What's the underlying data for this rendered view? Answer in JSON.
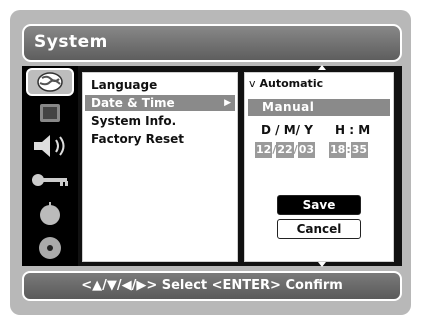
{
  "window": {
    "title": "System"
  },
  "sidebar_icons": [
    {
      "name": "globe-icon"
    },
    {
      "name": "monitor-icon"
    },
    {
      "name": "speaker-icon"
    },
    {
      "name": "key-icon"
    },
    {
      "name": "palette-icon"
    },
    {
      "name": "disc-icon"
    }
  ],
  "menu": {
    "items": [
      {
        "label": "Language"
      },
      {
        "label": "Date & Time",
        "selected": true
      },
      {
        "label": "System Info."
      },
      {
        "label": "Factory Reset"
      }
    ]
  },
  "datetime": {
    "automatic": {
      "check": "v",
      "label": "Automatic"
    },
    "manual_label": "Manual",
    "date_label": "D / M/ Y",
    "time_label": "H : M",
    "day": "12",
    "month": "22",
    "year": "03",
    "hour": "18",
    "minute": "35",
    "date_sep": "/",
    "time_sep": ":",
    "save_label": "Save",
    "cancel_label": "Cancel"
  },
  "hint": {
    "text": "<▲/▼/◀/▶> Select  <ENTER> Confirm"
  },
  "colors": {
    "panel_bg": "#ffffff",
    "highlight": "#8a8a8a",
    "chrome": "#5e5e5e"
  }
}
